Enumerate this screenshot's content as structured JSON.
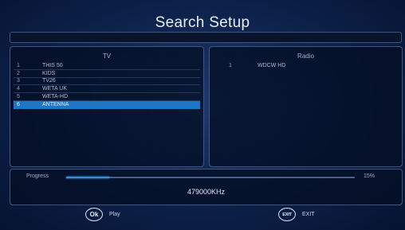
{
  "screen": {
    "title": "Search Setup"
  },
  "tv": {
    "header": "TV",
    "channels": [
      {
        "num": "1",
        "name": "THIS 50"
      },
      {
        "num": "2",
        "name": "KIDS"
      },
      {
        "num": "3",
        "name": "TV26"
      },
      {
        "num": "4",
        "name": "WETA UK"
      },
      {
        "num": "5",
        "name": "WETA-HD"
      },
      {
        "num": "6",
        "name": "ANTENNA"
      }
    ],
    "selected_index": 5
  },
  "radio": {
    "header": "Radio",
    "channels": [
      {
        "num": "1",
        "name": "WDCW HD"
      }
    ]
  },
  "progress": {
    "label": "Progress",
    "percent_text": "15%",
    "value": 0.15,
    "frequency": "479000KHz"
  },
  "footer": {
    "ok": {
      "icon_text": "Ok",
      "label": "Play"
    },
    "exit": {
      "icon_text": "EXIT",
      "label": "EXIT"
    }
  },
  "colors": {
    "accent": "#1b77c6",
    "background": "#0c2149"
  }
}
